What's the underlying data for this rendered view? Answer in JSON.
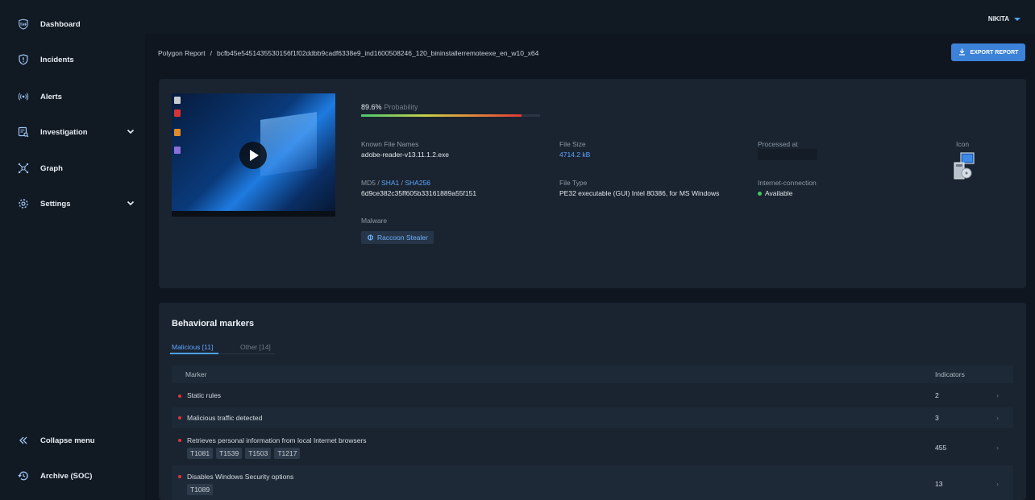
{
  "colors": {
    "accent": "#4da3ff",
    "danger": "#e0333b",
    "success": "#43c463"
  },
  "sidebar": {
    "items": [
      {
        "label": "Dashboard",
        "icon": "thf-logo-icon"
      },
      {
        "label": "Incidents",
        "icon": "shield-alert-icon"
      },
      {
        "label": "Alerts",
        "icon": "broadcast-icon"
      },
      {
        "label": "Investigation",
        "icon": "search-doc-icon"
      },
      {
        "label": "Graph",
        "icon": "graph-icon"
      },
      {
        "label": "Settings",
        "icon": "gear-icon"
      }
    ],
    "collapse_label": "Collapse menu",
    "archive_label": "Archive (SOC)"
  },
  "topbar": {
    "user": "NIKITA"
  },
  "breadcrumb": {
    "root": "Polygon Report",
    "separator": "/",
    "current": "bcfb45e5451435530156f1f02ddbb9cadf6338e9_ind1600508246_120_bininstallerremoteexe_en_w10_x64"
  },
  "export_label": "EXPORT REPORT",
  "report": {
    "probability_value": "89.6%",
    "probability_label": "Probability",
    "probability_fraction": 0.896,
    "known_file_names_label": "Known File Names",
    "known_file_names": "adobe-reader-v13.11.1.2.exe",
    "file_size_label": "File Size",
    "file_size": "4714.2 kB",
    "processed_at_label": "Processed at",
    "icon_label": "Icon",
    "hash_label_md5": "MD5",
    "hash_label_sha1": "SHA1",
    "hash_label_sha256": "SHA256",
    "hash_sep": " / ",
    "md5": "6d9ce382c35ff605b33161889a55f151",
    "file_type_label": "File Type",
    "file_type": "PE32 executable (GUI) Intel 80386, for MS Windows",
    "internet_label": "Internet-connection",
    "internet_value": "Available",
    "malware_label": "Malware",
    "malware_tag": "Raccoon Stealer"
  },
  "markers": {
    "title": "Behavioral markers",
    "tab_malicious": "Malicious [11]",
    "tab_other": "Other [14]",
    "col_marker": "Marker",
    "col_indicators": "Indicators",
    "rows": [
      {
        "name": "Static rules",
        "count": "2",
        "tags": []
      },
      {
        "name": "Malicious traffic detected",
        "count": "3",
        "tags": []
      },
      {
        "name": "Retrieves personal information from local Internet browsers",
        "count": "455",
        "tags": [
          "T1081",
          "T1539",
          "T1503",
          "T1217"
        ]
      },
      {
        "name": "Disables Windows Security options",
        "count": "13",
        "tags": [
          "T1089"
        ]
      }
    ]
  }
}
